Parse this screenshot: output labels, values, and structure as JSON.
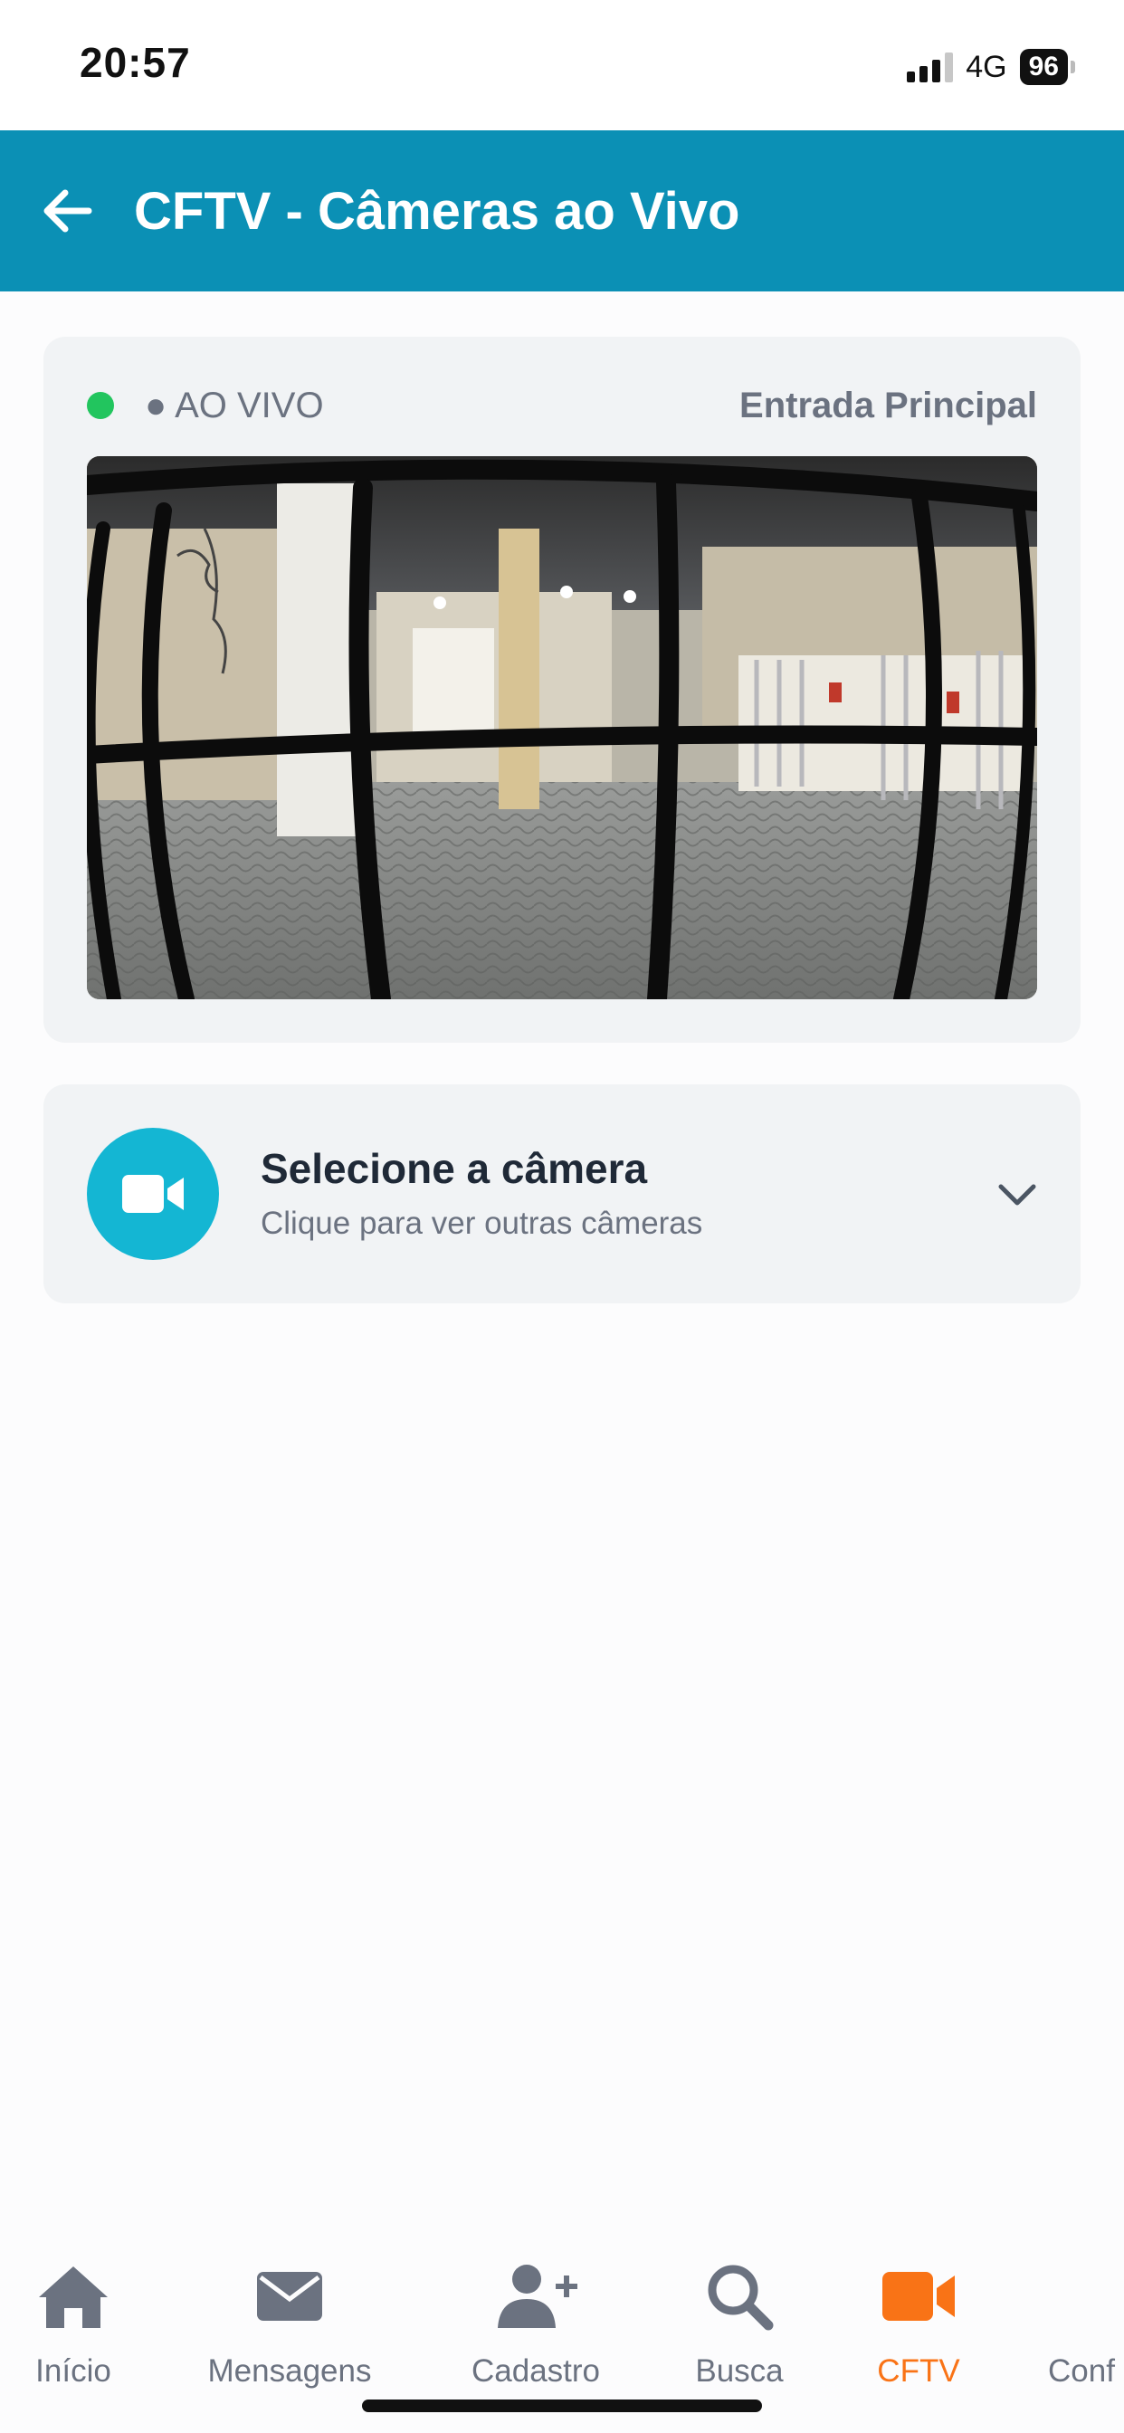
{
  "status_bar": {
    "time": "20:57",
    "network": "4G",
    "battery": "96"
  },
  "header": {
    "title": "CFTV - Câmeras ao Vivo",
    "back_icon": "arrow-left-icon",
    "background": "#0b90b5"
  },
  "camera": {
    "live_label": "● AO VIVO",
    "live_status_color": "#22c55e",
    "camera_name": "Entrada Principal"
  },
  "selector": {
    "title": "Selecione a câmera",
    "subtitle": "Clique para ver outras câmeras",
    "icon": "video-camera-icon",
    "icon_bg": "#14b6d3"
  },
  "bottom_nav": {
    "active_color": "#f97316",
    "items": [
      {
        "label": "Início",
        "icon": "home-icon"
      },
      {
        "label": "Mensagens",
        "icon": "envelope-icon"
      },
      {
        "label": "Cadastro",
        "icon": "user-plus-icon"
      },
      {
        "label": "Busca",
        "icon": "search-icon"
      },
      {
        "label": "CFTV",
        "icon": "video-camera-icon",
        "active": true
      },
      {
        "label": "Conf",
        "icon": "settings-icon"
      }
    ]
  }
}
